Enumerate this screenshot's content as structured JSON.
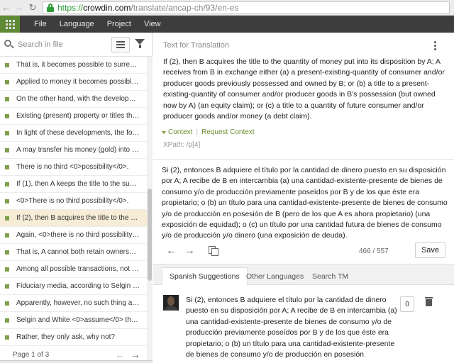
{
  "browser": {
    "url_scheme": "https://",
    "url_host": "crowdin.com",
    "url_path": "/translate/ancap-ch/93/en-es"
  },
  "menu": {
    "items": [
      "File",
      "Language",
      "Project",
      "View"
    ]
  },
  "sidebar": {
    "search_placeholder": "Search in file",
    "strings": [
      "That is, it becomes possible to surrender...",
      "Applied to money it becomes possible th...",
      "On the other hand, with the development...",
      "Existing (present) property or titles there...",
      "In light of these developments, the follo...",
      "A may transfer his money (gold) into B's...",
      "There is no third <0>possibility</0>.",
      "If (1), then A keeps the title to the sum of...",
      "<0>There is no third possibility</0>.",
      "If (2), then B acquires the title to the qua...",
      "Again, <0>there is no third possibility</0>...",
      "That is, A cannot both retain ownership ...",
      "Among all possible transactions, not one...",
      "Fiduciary media, according to Selgin and...",
      "Apparently, however, no such thing as \"m...",
      "Selgin and White <0>assume</0> the exi...",
      "Rather, they only ask, why not?"
    ],
    "active_index": 9,
    "pager": "Page 1 of 3"
  },
  "source": {
    "section_title": "Text for Translation",
    "text": "If (2), then B acquires the title to the quantity of money put into its disposition by A; A receives from B in exchange either (a) a present-existing-quantity of consumer and/or producer goods previously possessed and owned by B; or (b) a title to a present-existing-quantity of consumer and/or producer goods in B's possession (but owned now by A) (an equity claim); or (c) a title to a quantity of future consumer and/or producer goods and/or money (a debt claim).",
    "context_label": "Context",
    "request_context_label": "Request Context",
    "xpath": "XPath: /p[4]"
  },
  "translation": {
    "text": "Si (2), entonces B adquiere el título por la cantidad de dinero puesto en su disposición por A; A recibe de B en intercambia (a) una cantidad-existente-presente de bienes de consumo y/o de producción previamente poseídos por B y de los que éste era propietario; o (b) un título para una cantidad-existente-presente de bienes de consumo y/o de producción en posesión de B (pero de los que A es ahora propietario) (una exposición de equidad); o (c) un título por una cantidad futura de bienes de consumo y/o de producción y/o dinero (una exposición de deuda).",
    "counter": "466 / 557",
    "save_label": "Save"
  },
  "tabs": [
    "Spanish Suggestions",
    "Other Languages",
    "Search TM"
  ],
  "suggestion": {
    "text": "Si (2), entonces B adquiere el título por la cantidad de dinero puesto en su disposición por A; A recibe de B en intercambia (a) una cantidad-existente-presente de bienes de consumo y/o de producción previamente poseídos por B y de los que éste era propietario; o (b) un título para una cantidad-existente-presente de bienes de consumo y/o de producción en posesión",
    "votes": "0"
  }
}
